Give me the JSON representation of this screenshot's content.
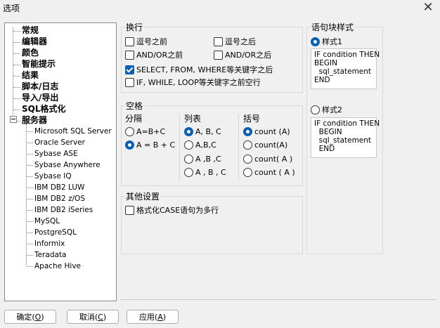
{
  "window": {
    "title": "选项",
    "close_glyph": "✕"
  },
  "tree": {
    "top_items": [
      {
        "label": "常规"
      },
      {
        "label": "编辑器"
      },
      {
        "label": "颜色"
      },
      {
        "label": "智能提示"
      },
      {
        "label": "结果"
      },
      {
        "label": "脚本/日志"
      },
      {
        "label": "导入/导出"
      },
      {
        "label": "SQL格式化"
      },
      {
        "label": "服务器"
      }
    ],
    "server_children": [
      "Microsoft SQL Server",
      "Oracle Server",
      "Sybase ASE",
      "Sybase Anywhere",
      "Sybase IQ",
      "IBM DB2 LUW",
      "IBM DB2 z/OS",
      "IBM DB2 iSeries",
      "MySQL",
      "PostgreSQL",
      "Informix",
      "Teradata",
      "Apache Hive"
    ]
  },
  "wrap": {
    "title": "换行",
    "comma_before": {
      "label": "逗号之前",
      "checked": false
    },
    "comma_after": {
      "label": "逗号之后",
      "checked": false
    },
    "andor_before": {
      "label": "AND/OR之前",
      "checked": false
    },
    "andor_after": {
      "label": "AND/OR之后",
      "checked": false
    },
    "select_keywords": {
      "label": "SELECT, FROM, WHERE等关键字之后",
      "checked": true
    },
    "if_keywords": {
      "label": "IF, WHILE, LOOP等关键字之前空行",
      "checked": false
    }
  },
  "blockstyle": {
    "title": "语句块样式",
    "style1": {
      "label": "样式1",
      "checked": true
    },
    "style2": {
      "label": "样式2",
      "checked": false
    },
    "preview1": [
      "IF condition THEN",
      "BEGIN",
      "  sql_statement",
      "END"
    ],
    "preview2": [
      "IF condition THEN",
      "  BEGIN",
      "  sql_statement",
      "  END"
    ]
  },
  "spacing": {
    "title": "空格",
    "sep_label": "分隔",
    "list_label": "列表",
    "paren_label": "括号",
    "sep_options": [
      {
        "label": "A=B+C",
        "checked": false
      },
      {
        "label": "A = B + C",
        "checked": true
      }
    ],
    "list_options": [
      {
        "label": "A, B, C",
        "checked": true
      },
      {
        "label": "A,B,C",
        "checked": false
      },
      {
        "label": "A ,B ,C",
        "checked": false
      },
      {
        "label": "A , B , C",
        "checked": false
      }
    ],
    "paren_options": [
      {
        "label": "count (A)",
        "checked": true
      },
      {
        "label": "count(A)",
        "checked": false
      },
      {
        "label": "count( A )",
        "checked": false
      },
      {
        "label": "count ( A )",
        "checked": false
      }
    ]
  },
  "other": {
    "title": "其他设置",
    "case_multiline": {
      "label": "格式化CASE语句为多行",
      "checked": false
    }
  },
  "buttons": {
    "ok": {
      "text": "确定(",
      "key": "O",
      "tail": ")"
    },
    "cancel": {
      "text": "取消(",
      "key": "C",
      "tail": ")"
    },
    "apply": {
      "text": "应用(",
      "key": "A",
      "tail": ")"
    }
  },
  "colors": {
    "accent": "#0a5fb4"
  }
}
